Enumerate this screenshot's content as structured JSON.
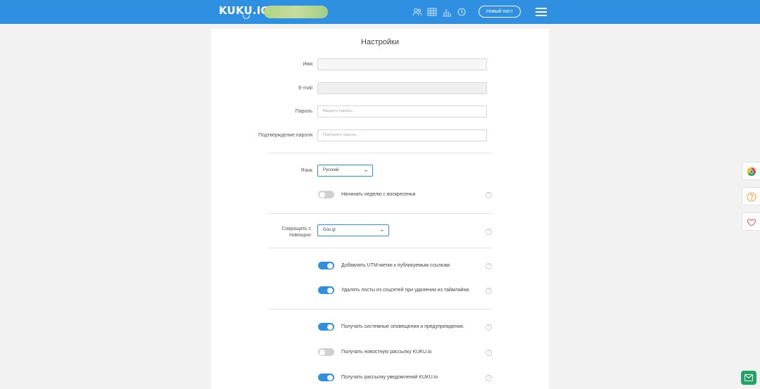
{
  "header": {
    "logo": "KUKU.IO",
    "new_post": "Новый пост",
    "nav_icons": [
      "users-icon",
      "calendar-grid-icon",
      "stats-icon",
      "clock-icon"
    ],
    "accent": "#2f8fe0"
  },
  "settings": {
    "title": "Настройки",
    "name_label": "Имя",
    "name_value": "",
    "email_label": "E-mail",
    "email_value": "",
    "password_label": "Пароль",
    "password_placeholder": "Введите пароль...",
    "confirm_label": "Подтверждение пароля",
    "confirm_placeholder": "Повторите пароль...",
    "language_label": "Язык",
    "language_value": "Русский",
    "week_sunday_label": "Начинать неделю с воскресенья",
    "week_sunday_on": false,
    "shorten_label_1": "Сокращать с",
    "shorten_label_2": "помощью",
    "shorten_value": "Goo.gl",
    "utm_label": "Добавлять UTM-метки к публикуемым ссылкам",
    "utm_on": true,
    "delete_posts_label": "Удалять посты из соцсетей при удалении из таймлайна",
    "delete_posts_on": true,
    "system_alerts_label": "Получать системные оповещения и предупреждения.",
    "system_alerts_on": true,
    "newsletter_label": "Получать новостную рассылку KUKU.io",
    "newsletter_on": false,
    "notify_label": "Получать рассылку уведомлений KUKU.io",
    "notify_on": true,
    "help_glyph": "?"
  }
}
